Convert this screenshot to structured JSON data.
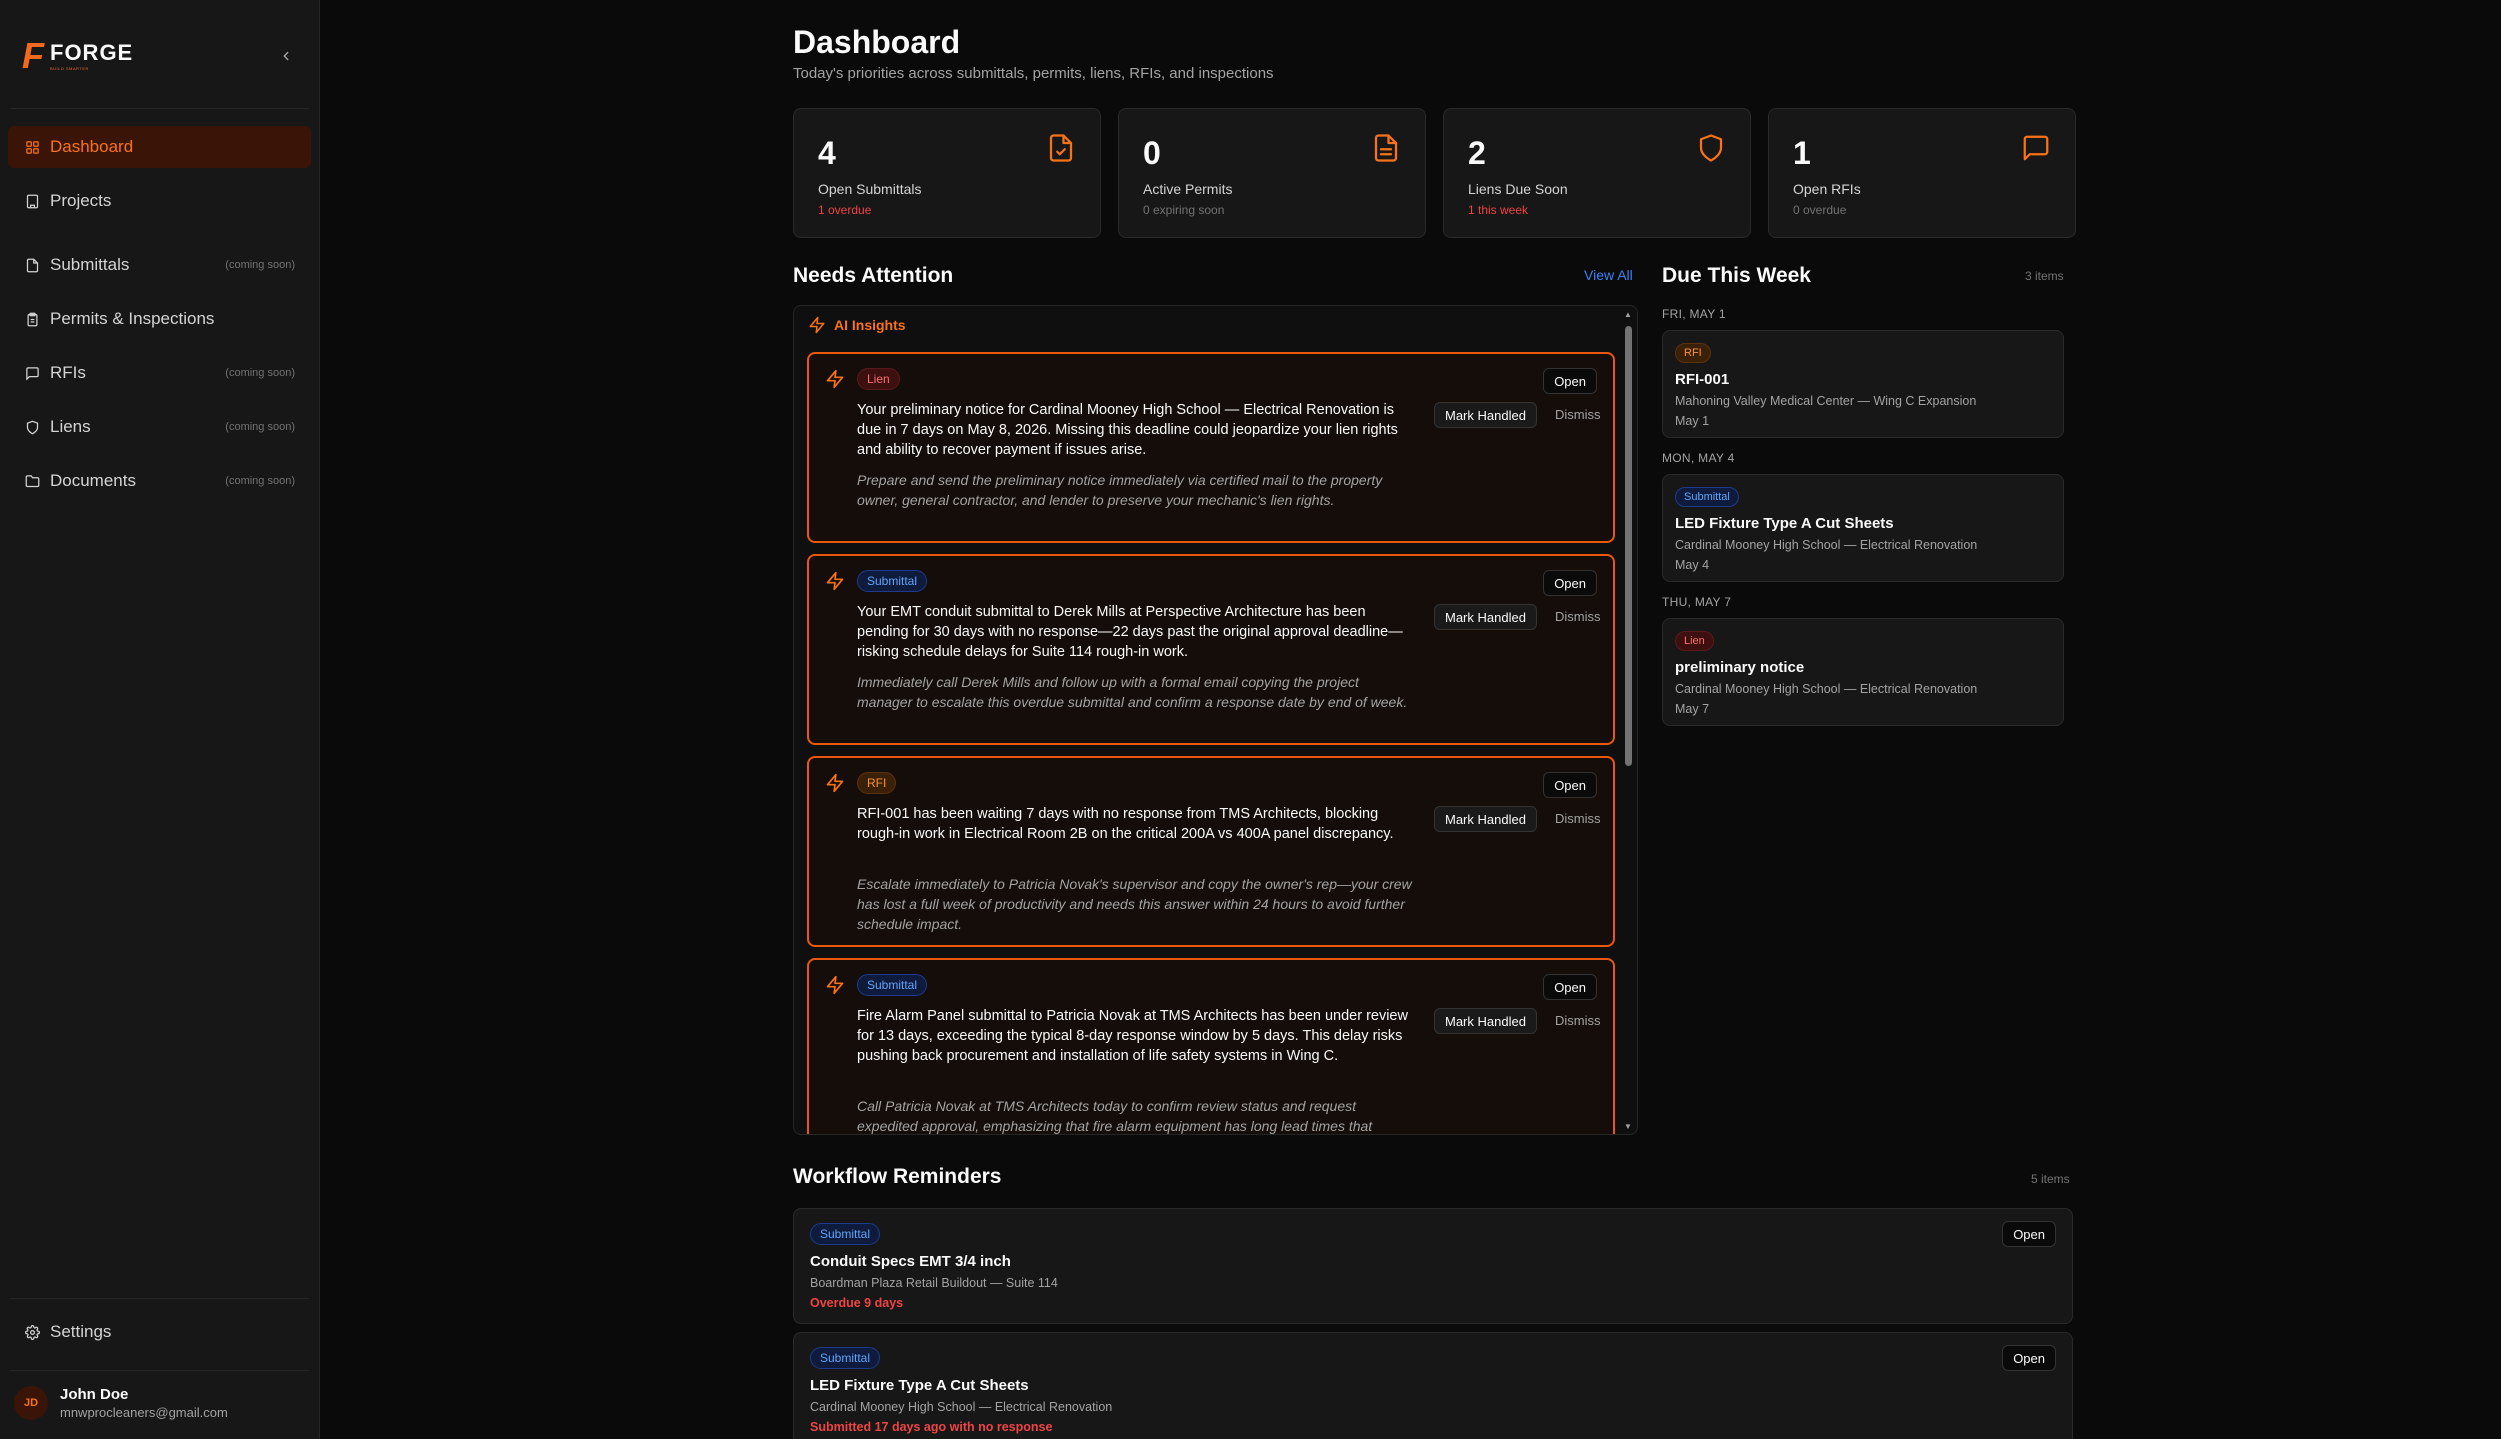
{
  "brand": {
    "name": "FORGE",
    "mark": "F",
    "tagline": "BUILD SMARTER",
    "accent": "#f97316"
  },
  "sidebar": {
    "items": [
      {
        "label": "Dashboard",
        "soon": ""
      },
      {
        "label": "Projects",
        "soon": ""
      },
      {
        "label": "Submittals",
        "soon": "(coming soon)"
      },
      {
        "label": "Permits & Inspections",
        "soon": ""
      },
      {
        "label": "RFIs",
        "soon": "(coming soon)"
      },
      {
        "label": "Liens",
        "soon": "(coming soon)"
      },
      {
        "label": "Documents",
        "soon": "(coming soon)"
      }
    ],
    "settings": "Settings",
    "user": {
      "initials": "JD",
      "name": "John Doe",
      "email": "mnwprocleaners@gmail.com"
    }
  },
  "header": {
    "title": "Dashboard",
    "subtitle": "Today's priorities across submittals, permits, liens, RFIs, and inspections"
  },
  "stats": [
    {
      "value": "4",
      "label": "Open Submittals",
      "note": "1 overdue",
      "icon": "file-check-icon"
    },
    {
      "value": "0",
      "label": "Active Permits",
      "note": "0 expiring soon",
      "icon": "file-text-icon"
    },
    {
      "value": "2",
      "label": "Liens Due Soon",
      "note": "1 this week",
      "icon": "shield-icon"
    },
    {
      "value": "1",
      "label": "Open RFIs",
      "note": "0 overdue",
      "icon": "message-square-icon"
    }
  ],
  "needs_attention": {
    "title": "Needs Attention",
    "view_all": "View All",
    "ai_label": "AI Insights",
    "open": "Open",
    "mark_handled": "Mark Handled",
    "dismiss": "Dismiss",
    "insights": [
      {
        "type": "Lien",
        "message": "Your preliminary notice for Cardinal Mooney High School — Electrical Renovation is due in 7 days on May 8, 2026. Missing this deadline could jeopardize your lien rights and ability to recover payment if issues arise.",
        "recommendation": "Prepare and send the preliminary notice immediately via certified mail to the property owner, general contractor, and lender to preserve your mechanic's lien rights."
      },
      {
        "type": "Submittal",
        "message": "Your EMT conduit submittal to Derek Mills at Perspective Architecture has been pending for 30 days with no response—22 days past the original approval deadline—risking schedule delays for Suite 114 rough-in work.",
        "recommendation": "Immediately call Derek Mills and follow up with a formal email copying the project manager to escalate this overdue submittal and confirm a response date by end of week."
      },
      {
        "type": "RFI",
        "message": "RFI-001 has been waiting 7 days with no response from TMS Architects, blocking rough-in work in Electrical Room 2B on the critical 200A vs 400A panel discrepancy.",
        "recommendation": "Escalate immediately to Patricia Novak's supervisor and copy the owner's rep—your crew has lost a full week of productivity and needs this answer within 24 hours to avoid further schedule impact."
      },
      {
        "type": "Submittal",
        "message": "Fire Alarm Panel submittal to Patricia Novak at TMS Architects has been under review for 13 days, exceeding the typical 8-day response window by 5 days. This delay risks pushing back procurement and installation of life safety systems in Wing C.",
        "recommendation": "Call Patricia Novak at TMS Architects today to confirm review status and request expedited approval, emphasizing that fire alarm equipment has long lead times that"
      }
    ]
  },
  "due_this_week": {
    "title": "Due This Week",
    "count": "3 items",
    "groups": [
      {
        "day": "FRI, MAY 1",
        "type": "RFI",
        "title": "RFI-001",
        "project": "Mahoning Valley Medical Center — Wing C Expansion",
        "date": "May 1"
      },
      {
        "day": "MON, MAY 4",
        "type": "Submittal",
        "title": "LED Fixture Type A Cut Sheets",
        "project": "Cardinal Mooney High School — Electrical Renovation",
        "date": "May 4"
      },
      {
        "day": "THU, MAY 7",
        "type": "Lien",
        "title": "preliminary notice",
        "project": "Cardinal Mooney High School — Electrical Renovation",
        "date": "May 7"
      }
    ]
  },
  "workflow": {
    "title": "Workflow Reminders",
    "count": "5 items",
    "open": "Open",
    "items": [
      {
        "type": "Submittal",
        "name": "Conduit Specs EMT 3/4 inch",
        "project": "Boardman Plaza Retail Buildout — Suite 114",
        "status": "Overdue 9 days"
      },
      {
        "type": "Submittal",
        "name": "LED Fixture Type A Cut Sheets",
        "project": "Cardinal Mooney High School — Electrical Renovation",
        "status": "Submitted 17 days ago with no response"
      }
    ]
  }
}
